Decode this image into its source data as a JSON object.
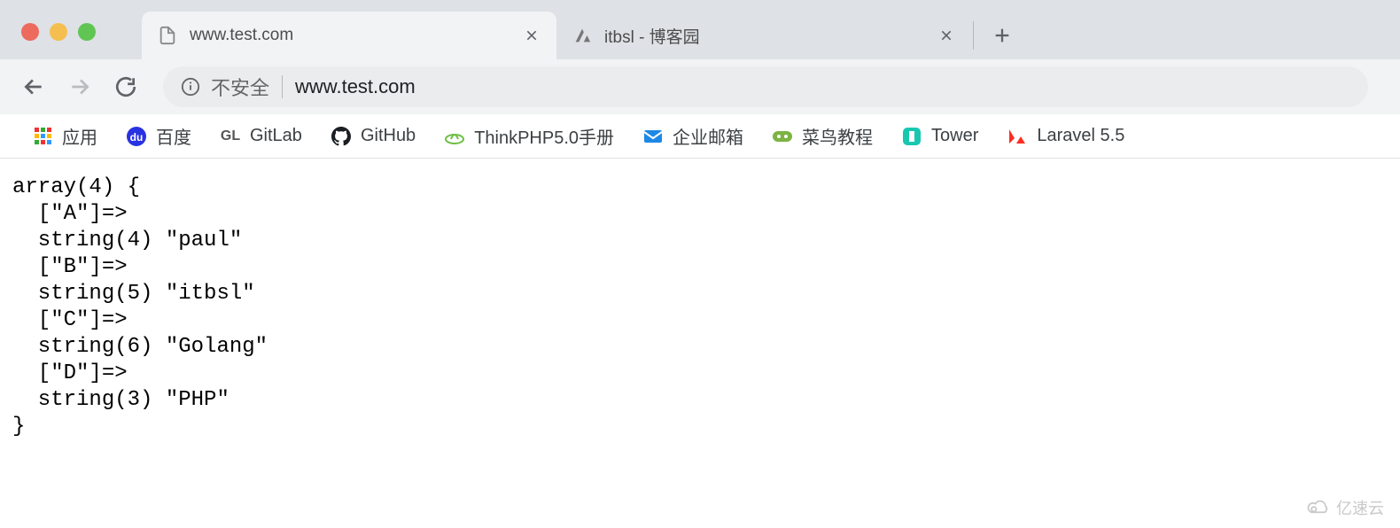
{
  "window": {
    "traffic": [
      "close",
      "minimize",
      "maximize"
    ]
  },
  "tabs": [
    {
      "title": "www.test.com",
      "active": true
    },
    {
      "title": "itbsl - 博客园",
      "active": false
    }
  ],
  "toolbar": {
    "insecure_label": "不安全",
    "url": "www.test.com"
  },
  "bookmarks": [
    {
      "label": "应用",
      "icon": "apps"
    },
    {
      "label": "百度",
      "icon": "baidu"
    },
    {
      "label": "GitLab",
      "icon": "gitlab"
    },
    {
      "label": "GitHub",
      "icon": "github"
    },
    {
      "label": "ThinkPHP5.0手册",
      "icon": "thinkphp"
    },
    {
      "label": "企业邮箱",
      "icon": "mail"
    },
    {
      "label": "菜鸟教程",
      "icon": "runoob"
    },
    {
      "label": "Tower",
      "icon": "tower"
    },
    {
      "label": "Laravel 5.5",
      "icon": "laravel"
    }
  ],
  "page_content": "array(4) {\n  [\"A\"]=>\n  string(4) \"paul\"\n  [\"B\"]=>\n  string(5) \"itbsl\"\n  [\"C\"]=>\n  string(6) \"Golang\"\n  [\"D\"]=>\n  string(3) \"PHP\"\n}",
  "watermark": "亿速云"
}
